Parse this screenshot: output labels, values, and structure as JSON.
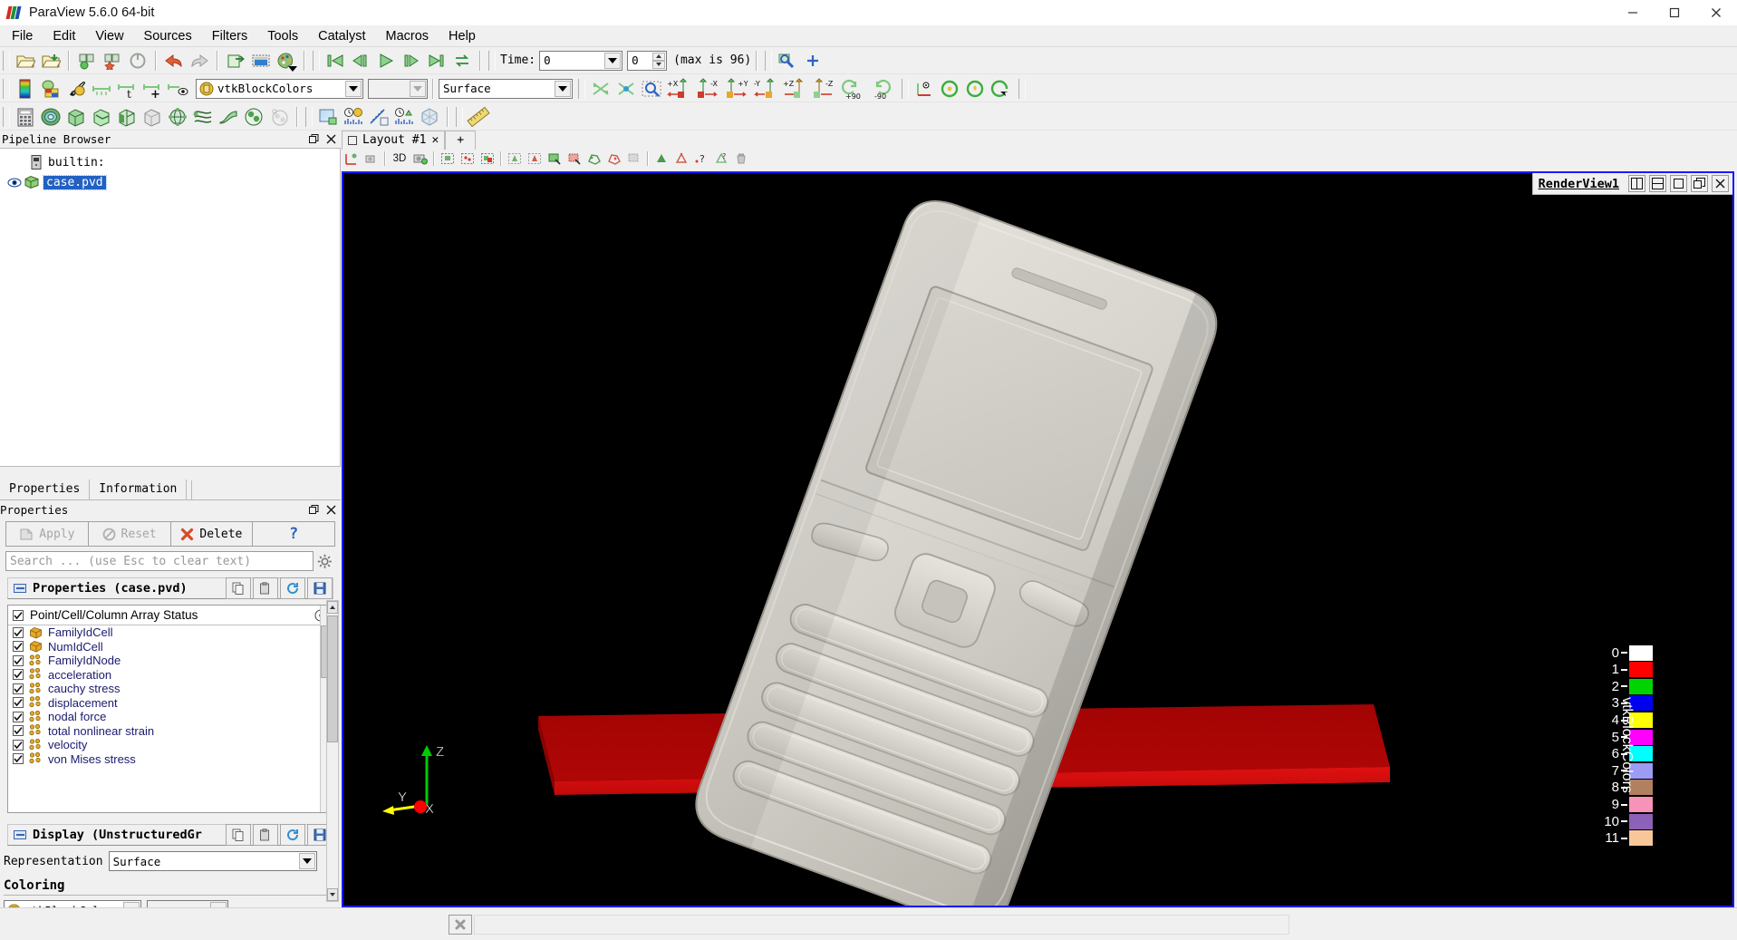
{
  "window": {
    "title": "ParaView 5.6.0 64-bit",
    "app_icon": "paraview-logo-icon",
    "minimize_label": "─",
    "maximize_label": "❐",
    "close_label": "✕"
  },
  "menubar": {
    "items": [
      "File",
      "Edit",
      "View",
      "Sources",
      "Filters",
      "Tools",
      "Catalyst",
      "Macros",
      "Help"
    ]
  },
  "toolbars": {
    "main": {
      "icons": [
        "open-file-icon",
        "open-recent-file-icon",
        "save-data-icon",
        "save-state-icon",
        "reload-icon",
        "undo-icon",
        "redo-icon",
        "connect-icon",
        "screenshot-icon",
        "color-palette-icon"
      ]
    },
    "vcr": {
      "icons": [
        "first-frame-icon",
        "previous-frame-icon",
        "play-icon",
        "next-frame-icon",
        "last-frame-icon",
        "loop-icon"
      ],
      "time_label": "Time:",
      "time_value": "0",
      "frame_value": "0",
      "max_label": "(max is 96)"
    },
    "camera_extra": {
      "icons": [
        "find-data-icon",
        "add-point-icon"
      ]
    },
    "representation": {
      "icons": [
        "color-map-icon",
        "rescale-data-range-icon",
        "edit-color-map-icon",
        "rescale-custom-icon",
        "rescale-temporal-icon",
        "rescale-visible-icon",
        "reset-range-icon"
      ],
      "array_value": "vtkBlockColors",
      "array_icon": "block-colors-icon",
      "component_value": "",
      "component_disabled": true,
      "representation_value": "Surface"
    },
    "camera": {
      "icons": [
        "reset-camera-icon",
        "zoom-to-data-icon",
        "zoom-to-box-icon",
        "set-view-plus-x-icon",
        "set-view-minus-x-icon",
        "set-view-plus-y-icon",
        "set-view-minus-y-icon",
        "set-view-plus-z-icon",
        "set-view-minus-z-icon",
        "rotate-90-cw-icon",
        "rotate-90-ccw-icon"
      ],
      "plus_x": "+X",
      "minus_x": "-X",
      "plus_y": "+Y",
      "minus_y": "-Y",
      "plus_z": "+Z",
      "minus_z": "-Z",
      "rot_cw": "+90",
      "rot_ccw": "-90"
    },
    "axes": {
      "icons": [
        "show-center-axes-icon",
        "reset-center-icon",
        "pick-center-icon",
        "rotate-center-icon"
      ]
    },
    "filters": {
      "icons": [
        "calculator-icon",
        "contour-icon",
        "clip-icon",
        "slice-icon",
        "threshold-icon",
        "extract-subset-icon",
        "glyph-icon",
        "stream-tracer-icon",
        "warp-icon",
        "group-datasets-icon",
        "extract-level-icon"
      ]
    },
    "data_analysis": {
      "icons": [
        "plot-data-icon",
        "plot-over-time-icon",
        "plot-over-line-icon",
        "plot-selection-over-time-icon",
        "quartile-chart-icon"
      ]
    },
    "measure": {
      "icons": [
        "ruler-icon"
      ]
    }
  },
  "pipeline_browser": {
    "title": "Pipeline Browser",
    "undock_label": "❐",
    "close_label": "✕",
    "items": [
      {
        "name": "builtin:",
        "icon": "server-icon",
        "selected": false,
        "visible": false,
        "indent": 1
      },
      {
        "name": "case.pvd",
        "icon": "dataset-icon",
        "selected": true,
        "visible": true,
        "indent": 1
      }
    ]
  },
  "properties_dock": {
    "tabs": [
      {
        "label": "Properties",
        "active": true
      },
      {
        "label": "Information",
        "active": false
      }
    ],
    "title": "Properties",
    "undock_label": "❐",
    "close_label": "✕",
    "buttons": [
      {
        "label": "Apply",
        "icon": "apply-icon",
        "enabled": false
      },
      {
        "label": "Reset",
        "icon": "reset-icon",
        "enabled": false
      },
      {
        "label": "Delete",
        "icon": "delete-icon",
        "enabled": true
      },
      {
        "label": "",
        "icon": "help-icon",
        "enabled": true
      }
    ],
    "search_placeholder": "Search ... (use Esc to clear text)",
    "gear_icon": "gear-icon",
    "source_section": {
      "title": "Properties (case.pvd)",
      "header_icons": [
        "copy-icon",
        "paste-icon",
        "restore-defaults-icon",
        "save-defaults-icon"
      ],
      "array_status_label": "Point/Cell/Column Array Status",
      "array_status_checked": true,
      "toggle_icon": "toggle-all-icon",
      "arrays": [
        {
          "label": "FamilyIdCell",
          "icon": "cell-data-icon",
          "checked": true
        },
        {
          "label": "NumIdCell",
          "icon": "cell-data-icon",
          "checked": true
        },
        {
          "label": "FamilyIdNode",
          "icon": "point-data-icon",
          "checked": true
        },
        {
          "label": "acceleration",
          "icon": "point-data-icon",
          "checked": true
        },
        {
          "label": "cauchy stress",
          "icon": "point-data-icon",
          "checked": true
        },
        {
          "label": "displacement",
          "icon": "point-data-icon",
          "checked": true
        },
        {
          "label": "nodal force",
          "icon": "point-data-icon",
          "checked": true
        },
        {
          "label": "total nonlinear strain",
          "icon": "point-data-icon",
          "checked": true
        },
        {
          "label": "velocity",
          "icon": "point-data-icon",
          "checked": true
        },
        {
          "label": "von Mises stress",
          "icon": "point-data-icon",
          "checked": true
        }
      ]
    },
    "display_section": {
      "title": "Display (UnstructuredGr",
      "header_icons": [
        "copy-icon",
        "paste-icon",
        "restore-defaults-icon",
        "save-defaults-icon"
      ],
      "representation_label": "Representation",
      "representation_value": "Surface",
      "coloring_label": "Coloring",
      "coloring_value": "vtkBlockColors",
      "coloring_icon": "block-colors-icon",
      "coloring_component": ""
    }
  },
  "layout": {
    "tab_label": "Layout #1",
    "tab_icon": "layout-icon",
    "tab_close": "✕",
    "add_tab_label": "+"
  },
  "view_toolbar": {
    "icons": [
      "interaction-mode-icon",
      "camera-undo-icon",
      "3d-toggle-label",
      "camera-lock-icon",
      "select-cells-on-icon",
      "select-points-on-icon",
      "select-cells-through-icon",
      "select-points-through-icon",
      "select-block-icon",
      "interactive-select-cells-icon",
      "select-cells-with-polygon-icon",
      "select-points-with-polygon-icon",
      "frustum-select-icon",
      "hover-cells-icon",
      "hover-points-icon",
      "query-icon",
      "extract-selection-icon",
      "clear-selection-icon"
    ],
    "three_d_label": "3D"
  },
  "render_view": {
    "name": "RenderView1",
    "buttons": [
      {
        "icon": "split-horizontal-icon"
      },
      {
        "icon": "split-vertical-icon"
      },
      {
        "icon": "maximize-view-icon"
      },
      {
        "icon": "undock-view-icon"
      },
      {
        "icon": "close-view-icon"
      }
    ],
    "background_color": "#000000",
    "objects": [
      {
        "name": "phone-case-mesh",
        "color": "#d5d2cb"
      },
      {
        "name": "red-floor-plate",
        "color": "#c20a0a"
      }
    ],
    "orientation_axes": {
      "x_label": "X",
      "y_label": "Y",
      "z_label": "Z",
      "x_color": "#ff0000",
      "y_color": "#ffff00",
      "z_color": "#00cc00"
    },
    "scalar_bar": {
      "title": "vtkBlockColors",
      "entries": [
        {
          "label": "0",
          "color": "#ffffff"
        },
        {
          "label": "1",
          "color": "#ff0000"
        },
        {
          "label": "2",
          "color": "#00d400"
        },
        {
          "label": "3",
          "color": "#0000ee"
        },
        {
          "label": "4",
          "color": "#ffff00"
        },
        {
          "label": "5",
          "color": "#ff00ff"
        },
        {
          "label": "6",
          "color": "#00ffff"
        },
        {
          "label": "7",
          "color": "#9c9cf5"
        },
        {
          "label": "8",
          "color": "#b08060"
        },
        {
          "label": "9",
          "color": "#f792b8"
        },
        {
          "label": "10",
          "color": "#8c62b8"
        },
        {
          "label": "11",
          "color": "#f7c79a"
        }
      ]
    }
  },
  "status_bar": {
    "cancel_icon": "cancel-icon",
    "progress_text": ""
  }
}
